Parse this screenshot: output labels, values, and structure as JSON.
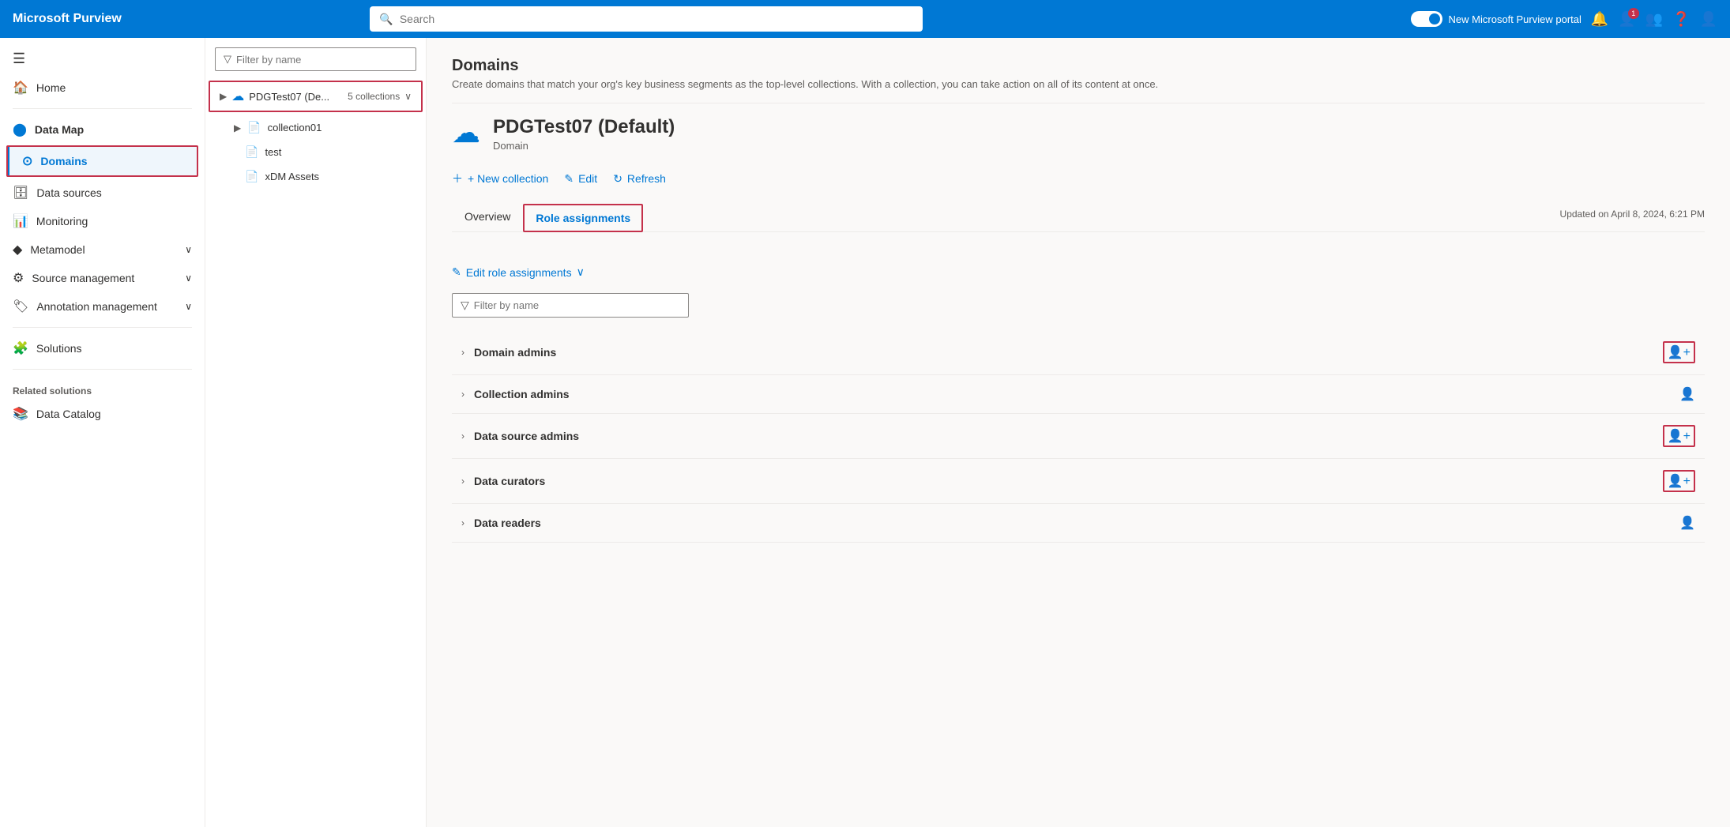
{
  "app": {
    "brand": "Microsoft Purview",
    "search_placeholder": "Search"
  },
  "topnav": {
    "toggle_label": "New Microsoft Purview portal",
    "icons": [
      "bell",
      "notification-badge",
      "people",
      "help",
      "user"
    ]
  },
  "sidebar": {
    "hamburger": "≡",
    "items": [
      {
        "id": "home",
        "label": "Home",
        "icon": "🏠"
      },
      {
        "id": "data-map",
        "label": "Data Map",
        "icon": "🔵",
        "is_section": true
      },
      {
        "id": "domains",
        "label": "Domains",
        "icon": "⊙",
        "active": true
      },
      {
        "id": "data-sources",
        "label": "Data sources",
        "icon": "🗄"
      },
      {
        "id": "monitoring",
        "label": "Monitoring",
        "icon": "📊"
      },
      {
        "id": "metamodel",
        "label": "Metamodel",
        "icon": "🔷",
        "has_chevron": true
      },
      {
        "id": "source-management",
        "label": "Source management",
        "icon": "⚙",
        "has_chevron": true
      },
      {
        "id": "annotation-management",
        "label": "Annotation management",
        "icon": "🏷",
        "has_chevron": true
      },
      {
        "id": "solutions",
        "label": "Solutions",
        "icon": "🧩"
      }
    ],
    "related_solutions_label": "Related solutions",
    "related_solutions": [
      {
        "id": "data-catalog",
        "label": "Data Catalog",
        "icon": "📚"
      }
    ]
  },
  "collection_panel": {
    "filter_placeholder": "Filter by name",
    "domain": {
      "name": "PDGTest07 (De...",
      "collections_count": "5 collections",
      "children": [
        {
          "id": "collection01",
          "name": "collection01",
          "icon": "📄"
        },
        {
          "id": "test",
          "name": "test",
          "icon": "📄"
        },
        {
          "id": "xdm-assets",
          "name": "xDM Assets",
          "icon": "📄"
        }
      ]
    }
  },
  "detail": {
    "title": "PDGTest07 (Default)",
    "subtitle": "Domain",
    "actions": {
      "new_collection": "+ New collection",
      "edit": "Edit",
      "refresh": "Refresh"
    },
    "tabs": [
      {
        "id": "overview",
        "label": "Overview",
        "active": false
      },
      {
        "id": "role-assignments",
        "label": "Role assignments",
        "active": true,
        "highlighted": true
      }
    ],
    "updated_text": "Updated on April 8, 2024, 6:21 PM",
    "edit_role_assignments": "Edit role assignments",
    "filter_by_name_placeholder": "Filter by name",
    "roles": [
      {
        "id": "domain-admins",
        "label": "Domain admins",
        "has_icon_box": true
      },
      {
        "id": "collection-admins",
        "label": "Collection admins",
        "has_icon_box": false
      },
      {
        "id": "data-source-admins",
        "label": "Data source admins",
        "has_icon_box": true
      },
      {
        "id": "data-curators",
        "label": "Data curators",
        "has_icon_box": true
      },
      {
        "id": "data-readers",
        "label": "Data readers",
        "has_icon_box": false
      }
    ]
  }
}
